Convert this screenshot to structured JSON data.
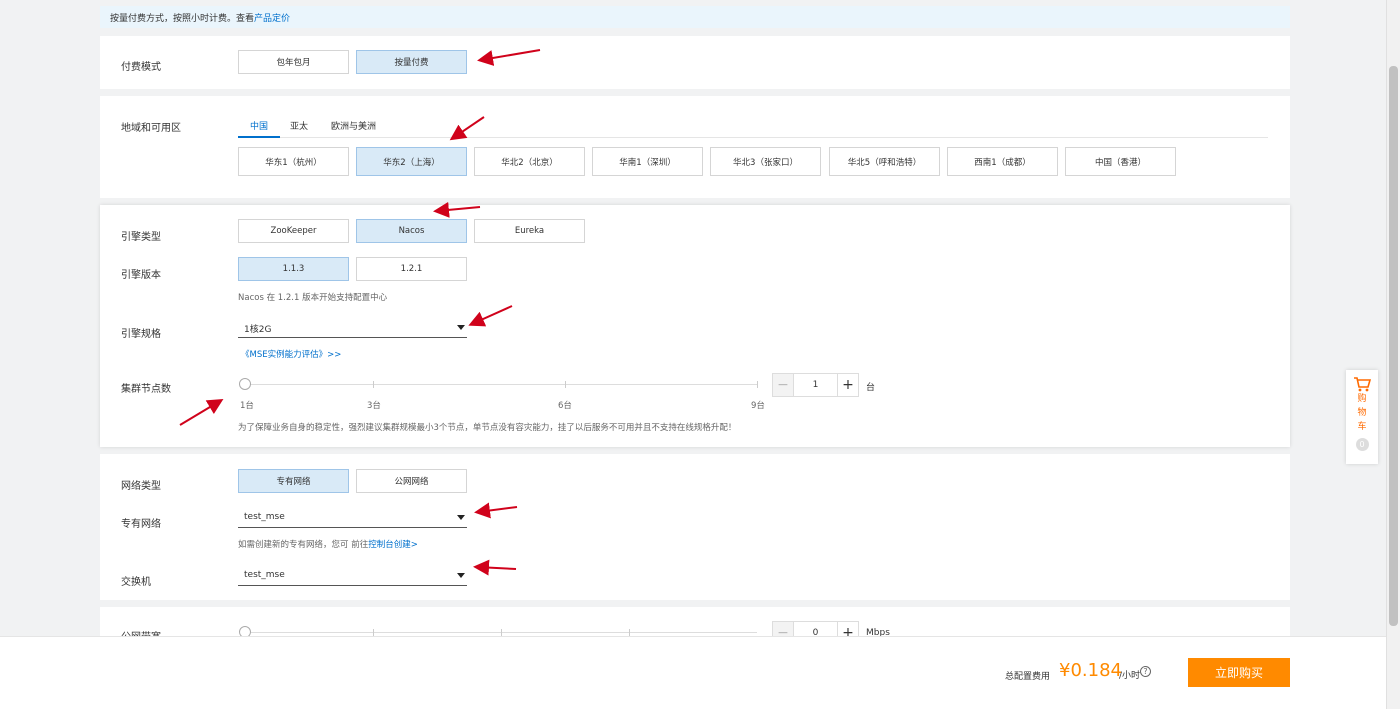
{
  "notice": {
    "text": "按量付费方式，按照小时计费。查看",
    "link": "产品定价"
  },
  "billing": {
    "label": "付费模式",
    "options": [
      "包年包月",
      "按量付费"
    ]
  },
  "region": {
    "label": "地域和可用区",
    "tabs": [
      "中国",
      "亚太",
      "欧洲与美洲"
    ],
    "zones": [
      "华东1（杭州）",
      "华东2（上海）",
      "华北2（北京）",
      "华南1（深圳）",
      "华北3（张家口）",
      "华北5（呼和浩特）",
      "西南1（成都）",
      "中国（香港）"
    ]
  },
  "engine_type": {
    "label": "引擎类型",
    "options": [
      "ZooKeeper",
      "Nacos",
      "Eureka"
    ]
  },
  "engine_version": {
    "label": "引擎版本",
    "options": [
      "1.1.3",
      "1.2.1"
    ],
    "hint": "Nacos 在 1.2.1 版本开始支持配置中心"
  },
  "engine_spec": {
    "label": "引擎规格",
    "value": "1核2G",
    "link": "《MSE实例能力评估》>>"
  },
  "nodes": {
    "label": "集群节点数",
    "ticks": [
      "1台",
      "3台",
      "6台",
      "9台"
    ],
    "value": "1",
    "unit": "台",
    "hint": "为了保障业务自身的稳定性，强烈建议集群规模最小3个节点，单节点没有容灾能力，挂了以后服务不可用并且不支持在线规格升配！"
  },
  "network_type": {
    "label": "网络类型",
    "options": [
      "专有网络",
      "公网网络"
    ]
  },
  "vpc": {
    "label": "专有网络",
    "value": "test_mse",
    "hint": "如需创建新的专有网络，您可 前往",
    "link": "控制台创建>"
  },
  "vswitch": {
    "label": "交换机",
    "value": "test_mse"
  },
  "bandwidth": {
    "label": "公网带宽",
    "value": "0",
    "unit": "Mbps"
  },
  "footer": {
    "cost_label": "总配置费用",
    "price": "¥0.184",
    "unit": "/小时",
    "help": "?",
    "buy": "立即购买"
  },
  "cart": {
    "chars": [
      "购",
      "物",
      "车"
    ],
    "count": "0"
  },
  "colors": {
    "accent": "#0070cc",
    "buy": "#ff8a00",
    "selected_bg": "#d9eaf7",
    "arrow": "#d0021b"
  }
}
